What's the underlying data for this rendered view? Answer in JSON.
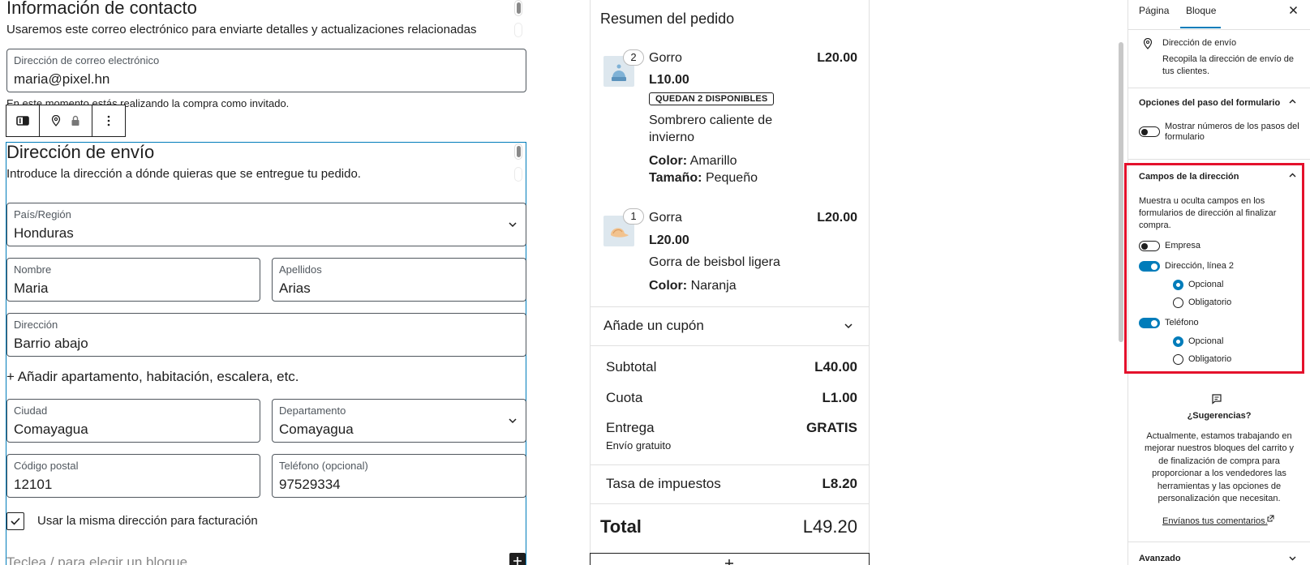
{
  "contact": {
    "heading": "Información de contacto",
    "description": "Usaremos este correo electrónico para enviarte detalles y actualizaciones relacionadas",
    "email_label": "Dirección de correo electrónico",
    "email_value": "maria@pixel.hn",
    "guest_note": "En este momento estás realizando la compra como invitado."
  },
  "shipping": {
    "heading": "Dirección de envío",
    "description": "Introduce la dirección a dónde quieras que se entregue tu pedido.",
    "country_label": "País/Región",
    "country_value": "Honduras",
    "first_name_label": "Nombre",
    "first_name_value": "Maria",
    "last_name_label": "Apellidos",
    "last_name_value": "Arias",
    "address_label": "Dirección",
    "address_value": "Barrio abajo",
    "add_apartment": "+ Añadir apartamento, habitación, escalera, etc.",
    "city_label": "Ciudad",
    "city_value": "Comayagua",
    "state_label": "Departamento",
    "state_value": "Comayagua",
    "postcode_label": "Código postal",
    "postcode_value": "12101",
    "phone_label": "Teléfono (opcional)",
    "phone_value": "97529334",
    "same_billing_label": "Usar la misma dirección para facturación",
    "same_billing_checked": true,
    "block_prompt": "Teclea / para elegir un bloque"
  },
  "order": {
    "title": "Resumen del pedido",
    "items": [
      {
        "qty": "2",
        "name": "Gorro",
        "total": "L20.00",
        "unit_price": "L10.00",
        "badge": "QUEDAN 2 DISPONIBLES",
        "description_line1": "Sombrero caliente de",
        "description_line2": "invierno",
        "attr1_key": "Color:",
        "attr1_val": "Amarillo",
        "attr2_key": "Tamaño:",
        "attr2_val": "Pequeño"
      },
      {
        "qty": "1",
        "name": "Gorra",
        "total": "L20.00",
        "unit_price": "L20.00",
        "description_line1": "Gorra de beisbol ligera",
        "attr1_key": "Color:",
        "attr1_val": "Naranja"
      }
    ],
    "coupon_label": "Añade un cupón",
    "subtotal_label": "Subtotal",
    "subtotal_value": "L40.00",
    "fee_label": "Cuota",
    "fee_value": "L1.00",
    "delivery_label": "Entrega",
    "delivery_value": "GRATIS",
    "delivery_note": "Envío gratuito",
    "tax_label": "Tasa de impuestos",
    "tax_value": "L8.20",
    "total_label": "Total",
    "total_value": "L49.20"
  },
  "sidebar": {
    "tab_page": "Página",
    "tab_block": "Bloque",
    "block_title": "Dirección de envío",
    "block_desc_line1": "Recopila la dirección de envío de",
    "block_desc_line2": "tus clientes.",
    "step_options_title": "Opciones del paso del formulario",
    "show_step_numbers_line1": "Mostrar números de los pasos del",
    "show_step_numbers_line2": "formulario",
    "show_step_numbers_on": false,
    "address_fields_title": "Campos de la dirección",
    "address_fields_desc_line1": "Muestra u oculta campos en los",
    "address_fields_desc_line2": "formularios de dirección al finalizar",
    "address_fields_desc_line3": "compra.",
    "company_label": "Empresa",
    "company_on": false,
    "address2_label": "Dirección, línea 2",
    "address2_on": true,
    "address2_optional": "Opcional",
    "address2_required": "Obligatorio",
    "phone_label": "Teléfono",
    "phone_on": true,
    "phone_optional": "Opcional",
    "phone_required": "Obligatorio",
    "suggestions_title": "¿Sugerencias?",
    "suggestions_line1": "Actualmente, estamos trabajando en",
    "suggestions_line2": "mejorar nuestros bloques del carrito y",
    "suggestions_line3": "de finalización de compra para",
    "suggestions_line4": "proporcionar a los vendedores las",
    "suggestions_line5": "herramientas y las opciones de",
    "suggestions_line6": "personalización que necesitan.",
    "feedback_link": "Envíanos tus comentarios.",
    "advanced_title": "Avanzado"
  },
  "colors": {
    "accent": "#007cba",
    "highlight": "#e4112c",
    "text": "#1e1e1e"
  }
}
